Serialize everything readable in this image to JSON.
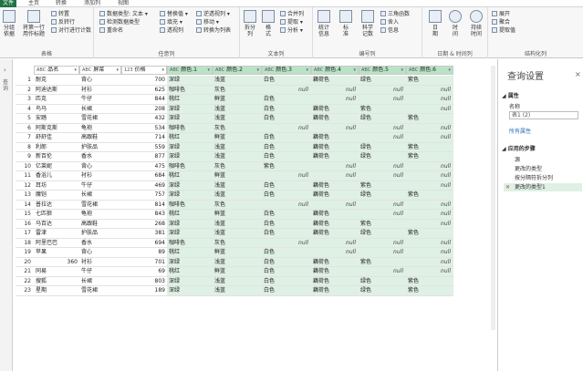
{
  "tabs": [
    "文件",
    "主页",
    "转换",
    "添加列",
    "视图"
  ],
  "ribbon": {
    "table_group": {
      "label": "表格",
      "btn_group": "分组\n依据",
      "btn_first_row": "将第一行\n用作标题",
      "small": [
        "转置",
        "反转行",
        "对行进行计数"
      ]
    },
    "anycol_group": {
      "label": "任意列",
      "small": [
        "数据类型: 文本",
        "检测数据类型",
        "重命名",
        "替换值",
        "填充",
        "透视列",
        "逆透视列",
        "移动",
        "转换为列表"
      ]
    },
    "textcol_group": {
      "label": "文本列",
      "btn_split": "拆分\n列",
      "btn_format": "格\n式",
      "small": [
        "合并列",
        "提取",
        "分析"
      ]
    },
    "numcol_group": {
      "label": "编号列",
      "btn_stats": "统计\n信息",
      "btn_std": "标\n准",
      "btn_sci": "科学\n记数",
      "small": [
        "三角函数",
        "舍入",
        "信息"
      ]
    },
    "datecol_group": {
      "label": "日期 & 时间列",
      "btn_date": "日\n期",
      "btn_time": "时\n间",
      "btn_dur": "持续\n时间"
    },
    "struct_group": {
      "label": "结构化列",
      "small": [
        "展开",
        "聚合",
        "提取值"
      ]
    }
  },
  "left_pane_label": "查询",
  "headers": [
    {
      "type": "ABC",
      "name": "品名"
    },
    {
      "type": "ABC",
      "name": "屏菜"
    },
    {
      "type": "123",
      "name": "价格"
    },
    {
      "type": "ABC",
      "name": "颜色.1"
    },
    {
      "type": "ABC",
      "name": "颜色.2"
    },
    {
      "type": "ABC",
      "name": "颜色.3"
    },
    {
      "type": "ABC",
      "name": "颜色.4"
    },
    {
      "type": "ABC",
      "name": "颜色.5"
    },
    {
      "type": "ABC",
      "name": "颜色.6"
    }
  ],
  "rows": [
    [
      "1",
      "耐克",
      "背心",
      "700",
      "深绿",
      "浅蓝",
      "白色",
      "藕荷色",
      "绿色",
      "紫色",
      "null"
    ],
    [
      "2",
      "阿迪达斯",
      "衬衫",
      "625",
      "咖啡色",
      "灰色",
      "null",
      "null",
      "null",
      "null"
    ],
    [
      "3",
      "匹克",
      "牛仔",
      "844",
      "桃红",
      "鲜蓝",
      "白色",
      "null",
      "null",
      "null"
    ],
    [
      "4",
      "鸟马",
      "长裙",
      "208",
      "深绿",
      "浅蓝",
      "白色",
      "藕荷色",
      "紫色",
      "null"
    ],
    [
      "5",
      "安踏",
      "雪花裙",
      "432",
      "深绿",
      "浅蓝",
      "白色",
      "藕荷色",
      "绿色",
      "紫色"
    ],
    [
      "6",
      "阿斯克斯",
      "龟袍",
      "534",
      "咖啡色",
      "灰色",
      "null",
      "null",
      "null",
      "null"
    ],
    [
      "7",
      "舒舒佳",
      "高跟鞋",
      "714",
      "桃红",
      "鲜蓝",
      "白色",
      "藕荷色",
      "null",
      "null"
    ],
    [
      "8",
      "利郎",
      "护肤品",
      "559",
      "深绿",
      "浅蓝",
      "白色",
      "藕荷色",
      "绿色",
      "紫色"
    ],
    [
      "9",
      "新百伦",
      "香水",
      "877",
      "深绿",
      "浅蓝",
      "白色",
      "藕荷色",
      "绿色",
      "紫色"
    ],
    [
      "10",
      "亿莱妮",
      "背心",
      "475",
      "咖啡色",
      "灰色",
      "紫色",
      "null",
      "null",
      "null"
    ],
    [
      "11",
      "香浴儿",
      "衬衫",
      "684",
      "桃红",
      "鲜蓝",
      "null",
      "null",
      "null",
      "null"
    ],
    [
      "12",
      "耳坊",
      "牛仔",
      "469",
      "深绿",
      "浅蓝",
      "白色",
      "藕荷色",
      "紫色",
      "null"
    ],
    [
      "13",
      "魔铠",
      "长裙",
      "757",
      "深绿",
      "浅蓝",
      "白色",
      "藕荷色",
      "绿色",
      "紫色"
    ],
    [
      "14",
      "普拉达",
      "雪花裙",
      "814",
      "咖啡色",
      "灰色",
      "null",
      "null",
      "null",
      "null"
    ],
    [
      "15",
      "七匹狼",
      "龟袍",
      "843",
      "桃红",
      "鲜蓝",
      "白色",
      "藕荷色",
      "null",
      "null"
    ],
    [
      "16",
      "马百达",
      "高跟鞋",
      "268",
      "深绿",
      "浅蓝",
      "白色",
      "藕荷色",
      "紫色",
      "null"
    ],
    [
      "17",
      "雷津",
      "护肤品",
      "381",
      "深绿",
      "浅蓝",
      "白色",
      "藕荷色",
      "绿色",
      "紫色"
    ],
    [
      "18",
      "阿里巴巴",
      "香水",
      "694",
      "咖啡色",
      "灰色",
      "null",
      "null",
      "null",
      "null"
    ],
    [
      "19",
      "苹果",
      "背心",
      "89",
      "桃红",
      "鲜蓝",
      "白色",
      "null",
      "null",
      "null"
    ],
    [
      "20",
      "360",
      "衬衫",
      "701",
      "深绿",
      "浅蓝",
      "白色",
      "藕荷色",
      "紫色",
      "null"
    ],
    [
      "21",
      "同易",
      "牛仔",
      "69",
      "桃红",
      "鲜蓝",
      "白色",
      "藕荷色",
      "null",
      "null"
    ],
    [
      "22",
      "搜狐",
      "长裙",
      "803",
      "深绿",
      "浅蓝",
      "白色",
      "藕荷色",
      "绿色",
      "紫色"
    ],
    [
      "23",
      "星期",
      "雪花裙",
      "189",
      "深绿",
      "浅蓝",
      "白色",
      "藕荷色",
      "绿色",
      "紫色"
    ]
  ],
  "query_settings": {
    "title": "查询设置",
    "props_header": "属性",
    "name_label": "名称",
    "name_value": "表1 (2)",
    "all_props": "所有属性",
    "steps_header": "应用的步骤",
    "steps": [
      "源",
      "更改的类型",
      "按分隔符拆分列",
      "更改的类型1"
    ]
  },
  "colors": {
    "accent": "#217346",
    "selected_col": "#dff0e4",
    "header_sel": "#b9e3c6"
  }
}
